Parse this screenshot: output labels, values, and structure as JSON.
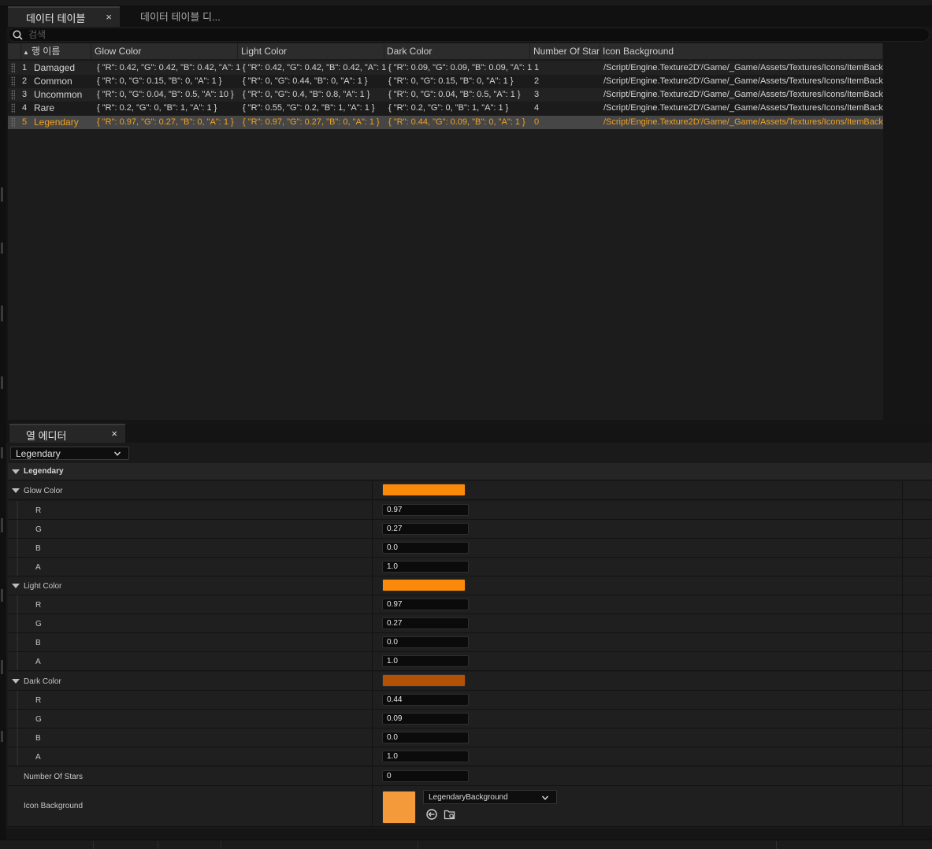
{
  "tabs": [
    {
      "label": "데이터 테이블",
      "close": "×",
      "active": true
    },
    {
      "label": "데이터 테이블 디...",
      "active": false
    }
  ],
  "search": {
    "placeholder": "검색",
    "icon": "search-icon"
  },
  "table": {
    "columns": [
      "행 이름",
      "Glow Color",
      "Light Color",
      "Dark Color",
      "Number Of Stars",
      "Icon Background"
    ],
    "rows": [
      {
        "num": "1",
        "name": "Damaged",
        "glow": "{ \"R\": 0.42, \"G\": 0.42, \"B\": 0.42, \"A\": 1 }",
        "light": "{ \"R\": 0.42, \"G\": 0.42, \"B\": 0.42, \"A\": 1 }",
        "dark": "{ \"R\": 0.09, \"G\": 0.09, \"B\": 0.09, \"A\": 1 }",
        "stars": "1",
        "icon": "/Script/Engine.Texture2D'/Game/_Game/Assets/Textures/Icons/ItemBack"
      },
      {
        "num": "2",
        "name": "Common",
        "glow": "{ \"R\": 0, \"G\": 0.15, \"B\": 0, \"A\": 1 }",
        "light": "{ \"R\": 0, \"G\": 0.44, \"B\": 0, \"A\": 1 }",
        "dark": "{ \"R\": 0, \"G\": 0.15, \"B\": 0, \"A\": 1 }",
        "stars": "2",
        "icon": "/Script/Engine.Texture2D'/Game/_Game/Assets/Textures/Icons/ItemBack"
      },
      {
        "num": "3",
        "name": "Uncommon",
        "glow": "{ \"R\": 0, \"G\": 0.04, \"B\": 0.5, \"A\": 10 }",
        "light": "{ \"R\": 0, \"G\": 0.4, \"B\": 0.8, \"A\": 1 }",
        "dark": "{ \"R\": 0, \"G\": 0.04, \"B\": 0.5, \"A\": 1 }",
        "stars": "3",
        "icon": "/Script/Engine.Texture2D'/Game/_Game/Assets/Textures/Icons/ItemBack"
      },
      {
        "num": "4",
        "name": "Rare",
        "glow": "{ \"R\": 0.2, \"G\": 0, \"B\": 1, \"A\": 1 }",
        "light": "{ \"R\": 0.55, \"G\": 0.2, \"B\": 1, \"A\": 1 }",
        "dark": "{ \"R\": 0.2, \"G\": 0, \"B\": 1, \"A\": 1 }",
        "stars": "4",
        "icon": "/Script/Engine.Texture2D'/Game/_Game/Assets/Textures/Icons/ItemBack"
      },
      {
        "num": "5",
        "name": "Legendary",
        "glow": "{ \"R\": 0.97, \"G\": 0.27, \"B\": 0, \"A\": 1 }",
        "light": "{ \"R\": 0.97, \"G\": 0.27, \"B\": 0, \"A\": 1 }",
        "dark": "{ \"R\": 0.44, \"G\": 0.09, \"B\": 0, \"A\": 1 }",
        "stars": "0",
        "icon": "/Script/Engine.Texture2D'/Game/_Game/Assets/Textures/Icons/ItemBack",
        "selected": true
      }
    ]
  },
  "column_editor": {
    "tab_label": "열 에디터",
    "tab_close": "×",
    "selected_row": "Legendary",
    "category": "Legendary",
    "glow": {
      "label": "Glow Color",
      "color": "#fb8a0b",
      "r": "0.97",
      "g": "0.27",
      "b": "0.0",
      "a": "1.0"
    },
    "light": {
      "label": "Light Color",
      "color": "#fb8a0b",
      "r": "0.97",
      "g": "0.27",
      "b": "0.0",
      "a": "1.0"
    },
    "dark": {
      "label": "Dark Color",
      "color": "#b35206",
      "r": "0.44",
      "g": "0.09",
      "b": "0.0",
      "a": "1.0"
    },
    "channel_labels": {
      "r": "R",
      "g": "G",
      "b": "B",
      "a": "A"
    },
    "stars": {
      "label": "Number Of Stars",
      "value": "0"
    },
    "icon_bg": {
      "label": "Icon Background",
      "asset": "LegendaryBackground",
      "thumb_color": "#f59a3a"
    }
  },
  "colors": {
    "selection_text": "#f0a020",
    "accent_orange": "#fb8a0b"
  }
}
